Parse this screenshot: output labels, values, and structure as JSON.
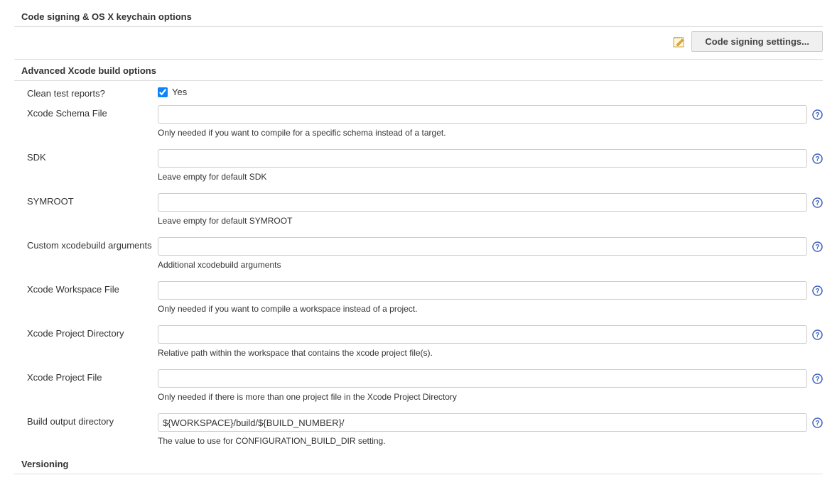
{
  "sections": {
    "code_signing_header": "Code signing & OS X keychain options",
    "advanced_header": "Advanced Xcode build options",
    "versioning_header": "Versioning"
  },
  "toolbar": {
    "code_signing_button": "Code signing settings..."
  },
  "fields": {
    "clean_test_reports": {
      "label": "Clean test reports?",
      "checkbox_label": "Yes",
      "checked": true
    },
    "xcode_schema": {
      "label": "Xcode Schema File",
      "value": "",
      "help": "Only needed if you want to compile for a specific schema instead of a target."
    },
    "sdk": {
      "label": "SDK",
      "value": "",
      "help": "Leave empty for default SDK"
    },
    "symroot": {
      "label": "SYMROOT",
      "value": "",
      "help": "Leave empty for default SYMROOT"
    },
    "custom_args": {
      "label": "Custom xcodebuild arguments",
      "value": "",
      "help": "Additional xcodebuild arguments"
    },
    "workspace": {
      "label": "Xcode Workspace File",
      "value": "",
      "help": "Only needed if you want to compile a workspace instead of a project."
    },
    "project_dir": {
      "label": "Xcode Project Directory",
      "value": "",
      "help": "Relative path within the workspace that contains the xcode project file(s)."
    },
    "project_file": {
      "label": "Xcode Project File",
      "value": "",
      "help": "Only needed if there is more than one project file in the Xcode Project Directory"
    },
    "build_output": {
      "label": "Build output directory",
      "value": "${WORKSPACE}/build/${BUILD_NUMBER}/",
      "help": "The value to use for CONFIGURATION_BUILD_DIR setting."
    }
  }
}
